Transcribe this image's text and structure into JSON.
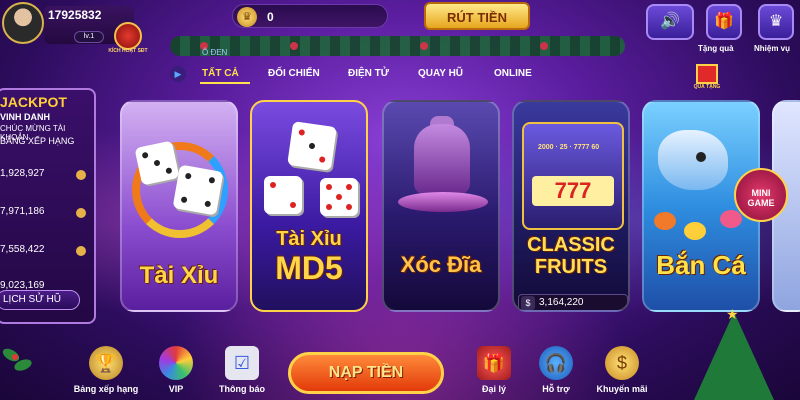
{
  "user": {
    "id": "17925832",
    "level": "lv.1",
    "badge_text": "KÍCH HOẠT SĐT"
  },
  "wallet": {
    "coin_icon": "crown-coin-icon",
    "balance": "0",
    "withdraw_label": "RÚT TIỀN"
  },
  "top_actions": [
    {
      "name": "sound",
      "icon": "speaker-icon",
      "label": ""
    },
    {
      "name": "gift",
      "icon": "gift-icon",
      "label": "Tặng quà"
    },
    {
      "name": "task",
      "icon": "crown-icon",
      "label": "Nhiệm vụ"
    }
  ],
  "tabs": {
    "hint": "Ô ĐEN",
    "items": [
      "TẤT CẢ",
      "ĐỐI CHIẾN",
      "ĐIỆN TỬ",
      "QUAY HŨ",
      "ONLINE"
    ],
    "active": "TẤT CẢ"
  },
  "jackpot": {
    "title": "JACKPOT",
    "sub1": "VINH DANH",
    "sub2": "CHÚC MỪNG TÀI KHOẢN",
    "sub3": "BẢNG XẾP HẠNG",
    "values": [
      "1,928,927",
      "7,971,186",
      "7,558,422",
      "9,023,169"
    ],
    "history_label": "LỊCH SỬ HŨ"
  },
  "games": [
    {
      "name": "tai-xiu",
      "title": "Tài Xỉu"
    },
    {
      "name": "tai-xiu-md5",
      "title1": "Tài Xỉu",
      "title2": "MD5"
    },
    {
      "name": "xoc-dia",
      "title": "Xóc Đĩa"
    },
    {
      "name": "classic-fruits",
      "title1": "CLASSIC",
      "title2": "FRUITS",
      "jackpot": "3,164,220",
      "reel": "777",
      "slot_nums": "2000 · 25 · 7777 60"
    },
    {
      "name": "ban-ca",
      "title": "Bắn Cá"
    }
  ],
  "promo": {
    "gift_label": "QUÀ TẶNG",
    "mini_game_line1": "MINI",
    "mini_game_line2": "GAME"
  },
  "bottom_nav": [
    {
      "name": "leaderboard",
      "icon": "trophy-icon",
      "label": "Bảng xếp hạng"
    },
    {
      "name": "vip",
      "icon": "wheel-icon",
      "label": "VIP"
    },
    {
      "name": "notifications",
      "icon": "clipboard-icon",
      "label": "Thông báo"
    },
    {
      "name": "agency",
      "icon": "gift-box-icon",
      "label": "Đại lý"
    },
    {
      "name": "support",
      "icon": "headset-icon",
      "label": "Hỗ trợ"
    },
    {
      "name": "promotion",
      "icon": "dollar-coin-icon",
      "label": "Khuyến mãi"
    }
  ],
  "deposit_label": "NẠP TIỀN",
  "colors": {
    "accent_gold": "#ffd24a",
    "background_purple": "#5a1d9e",
    "deposit_orange": "#e23a0a"
  }
}
